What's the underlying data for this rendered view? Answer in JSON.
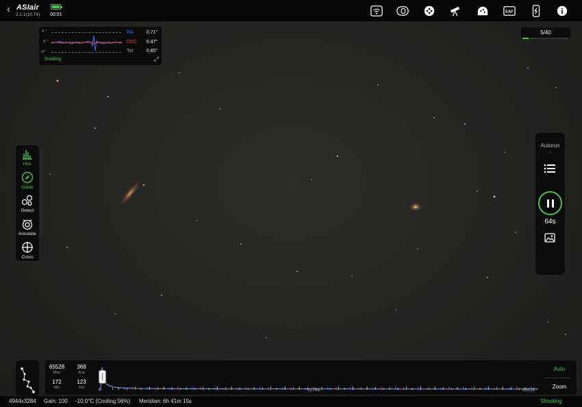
{
  "app": {
    "name": "ASIair",
    "version": "2.1.1(10.74)",
    "clock": "00:01",
    "accent_color": "#4fc34f"
  },
  "topbar_icons": [
    "wifi-icon",
    "storage-icon",
    "mount-icon",
    "telescope-icon",
    "observatory-icon",
    "eaf-icon",
    "usb-icon",
    "info-icon"
  ],
  "guide_graph": {
    "axis_top": "4 \"",
    "axis_mid": "0 \"",
    "axis_bot": "-4 \"",
    "ra_label": "RA",
    "ra_value": "0.71\"",
    "dec_label": "DEC",
    "dec_value": "0.47\"",
    "tot_label": "Tot",
    "tot_value": "0.85\"",
    "footer": "Guiding",
    "ra_color": "#3b6cff",
    "dec_color": "#e33b3b"
  },
  "progress": {
    "text": "5/40",
    "fraction": 0.125
  },
  "left_toolbar": [
    {
      "label": "Hist.",
      "icon": "histogram-icon",
      "active": true
    },
    {
      "label": "Guide",
      "icon": "guide-icon",
      "active": true
    },
    {
      "label": "Detect",
      "icon": "detect-icon",
      "active": false
    },
    {
      "label": "Annotate",
      "icon": "annotate-icon",
      "active": false
    },
    {
      "label": "Cross",
      "icon": "crosshair-icon",
      "active": false
    }
  ],
  "right_panel": {
    "autorun_label": "Autorun",
    "exposure_time": "64s",
    "state": "running"
  },
  "histogram": {
    "max_value": "65528",
    "max_label": "Max",
    "avg_value": "368",
    "avg_label": "Avg",
    "min_value": "172",
    "min_label": "Min",
    "std_value": "123",
    "std_label": "Std",
    "tick_start": "0",
    "tick_mid": "32768",
    "tick_end": "65535",
    "auto_label": "Auto",
    "zoom_label": "Zoom"
  },
  "status_bar": {
    "resolution": "4944x3284",
    "gain": "Gain: 100",
    "temperature": "-10.0°C (Cooling 56%)",
    "meridian": "Meridian: 6h 41m 15s",
    "state": "Shooting"
  }
}
